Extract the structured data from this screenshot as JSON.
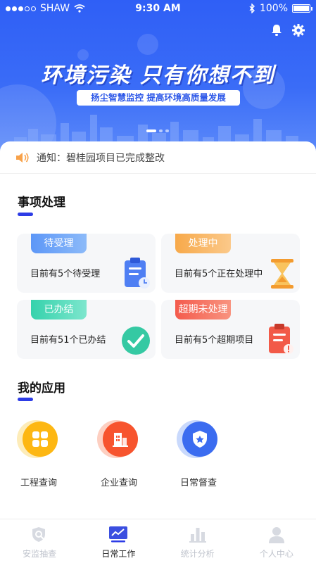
{
  "status_bar": {
    "carrier": "SHAW",
    "time": "9:30 AM",
    "battery": "100%"
  },
  "banner": {
    "title": "环境污染 只有你想不到",
    "subtitle": "扬尘智慧监控 提高环境高质量发展",
    "icons": [
      "bell-icon",
      "gear-icon"
    ],
    "carousel": {
      "pages": 3,
      "active": 1
    }
  },
  "notice": {
    "text": "通知：碧桂园项目已完成整改",
    "icon": "speaker-icon"
  },
  "tasks": {
    "title": "事项处理",
    "items": [
      {
        "tag": "待受理",
        "desc": "目前有5个待受理",
        "icon": "clipboard-clock-icon",
        "color": "#6aa2f8"
      },
      {
        "tag": "处理中",
        "desc": "目前有5个正在处理中",
        "icon": "hourglass-icon",
        "color": "#f8b25c"
      },
      {
        "tag": "已办结",
        "desc": "目前有51个已办结",
        "icon": "check-circle-icon",
        "color": "#47d8b7"
      },
      {
        "tag": "超期未处理",
        "desc": "目前有5个超期项目",
        "icon": "clipboard-alert-icon",
        "color": "#f5735f"
      }
    ]
  },
  "apps": {
    "title": "我的应用",
    "items": [
      {
        "label": "工程查询",
        "icon": "grid-icon",
        "color": "#fdb713"
      },
      {
        "label": "企业查询",
        "icon": "building-icon",
        "color": "#f7542e"
      },
      {
        "label": "日常督查",
        "icon": "shield-star-icon",
        "color": "#3b6cf0"
      }
    ]
  },
  "tabbar": {
    "active": "日常工作",
    "items": [
      {
        "label": "安监抽查",
        "icon": "search-shield-icon"
      },
      {
        "label": "日常工作",
        "icon": "chart-line-icon"
      },
      {
        "label": "统计分析",
        "icon": "bar-chart-icon"
      },
      {
        "label": "个人中心",
        "icon": "person-icon"
      }
    ]
  },
  "colors": {
    "primary": "#2f5ff6",
    "accent": "#2d3ce6",
    "active_tab": "#2d3ce6",
    "inactive_tab": "#bfc3cc"
  }
}
